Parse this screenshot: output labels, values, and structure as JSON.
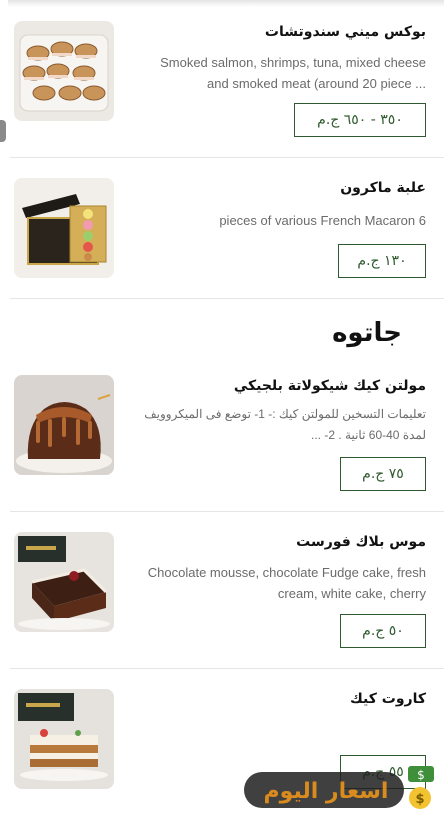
{
  "items_top": [
    {
      "title": "بوكس ميني سندوتشات",
      "desc": "Smoked salmon, shrimps, tuna, mixed cheese and smoked meat (around 20 piece ...",
      "price": "٣٥٠ - ٦٥٠ ج.م",
      "thumb": "mini-sandwich-box-photo"
    },
    {
      "title": "علبة ماكرون",
      "desc": "6 pieces of various French Macaron",
      "price": "١٣٠ ج.م",
      "thumb": "macaron-box-photo"
    }
  ],
  "section": {
    "title": "جاتوه"
  },
  "items_gateau": [
    {
      "title": "مولتن كيك شيكولاتة بلجيكي",
      "desc": "تعليمات التسخين للمولتن كيك :- 1- توضع فى الميكروويف لمدة 40-60 ثانية . 2- ...",
      "price": "٧٥ ج.م",
      "thumb": "molten-cake-photo"
    },
    {
      "title": "موس بلاك فورست",
      "desc": "Chocolate mousse, chocolate Fudge cake, fresh cream, white cake, cherry",
      "price": "٥٠ ج.م",
      "thumb": "black-forest-mousse-photo"
    },
    {
      "title": "كاروت كيك",
      "desc": "",
      "price": "٥٥ ج.م",
      "thumb": "carrot-cake-photo"
    }
  ],
  "watermark": {
    "text": "اسعار اليوم"
  },
  "colors": {
    "accent": "#2f5a2f",
    "text": "#111111",
    "muted": "#6b6b6b",
    "divider": "#e6e6e6"
  }
}
